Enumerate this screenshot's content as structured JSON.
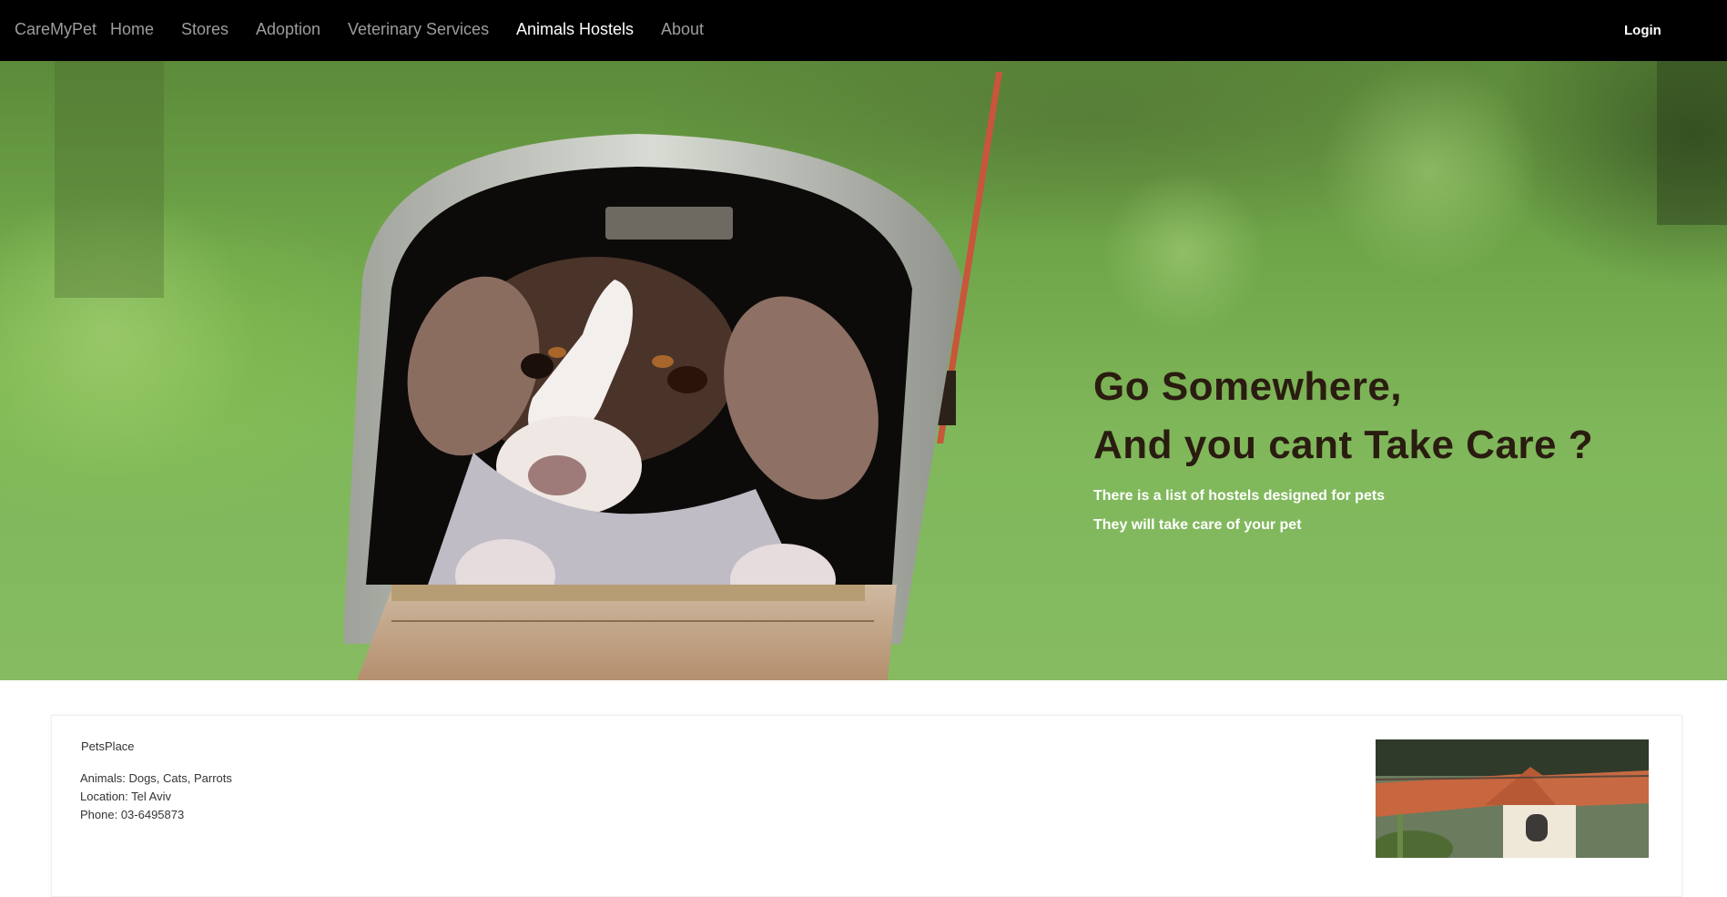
{
  "navbar": {
    "brand": "CareMyPet",
    "links": [
      {
        "label": "Home"
      },
      {
        "label": "Stores"
      },
      {
        "label": "Adoption"
      },
      {
        "label": "Veterinary Services"
      },
      {
        "label": "Animals Hostels",
        "active": true
      },
      {
        "label": "About"
      }
    ],
    "login_label": "Login"
  },
  "hero": {
    "title_line1": "Go Somewhere,",
    "title_line2": "And you cant Take Care ?",
    "subtitle_line1": "There is a list of hostels designed for pets",
    "subtitle_line2": "They will take care of your pet"
  },
  "hostels": [
    {
      "name": "PetsPlace",
      "animals": "Animals: Dogs, Cats, Parrots",
      "location": "Location: Tel Aviv",
      "phone": "Phone: 03-6495873"
    }
  ],
  "colors": {
    "navbar_bg": "#000000",
    "nav_link": "#9d9d9d",
    "nav_link_active": "#ffffff",
    "hero_title": "#2a1c10",
    "hero_subtitle": "#ffffff"
  }
}
